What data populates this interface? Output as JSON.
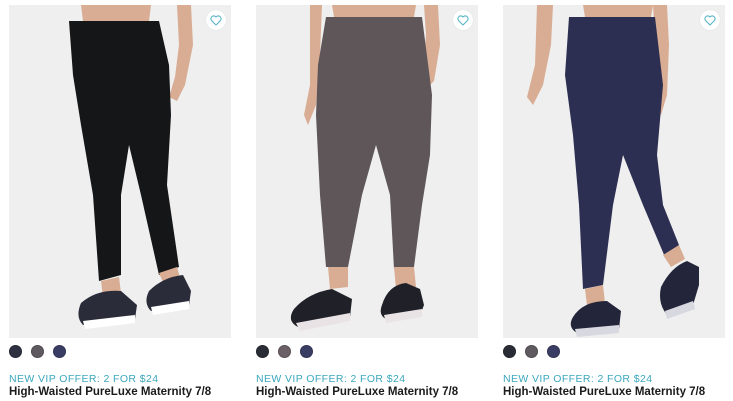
{
  "colors": {
    "photo_bg": "#efefef",
    "offer_text": "#3aa7bd",
    "heart": "#58b5c6",
    "skin": "#d9ad93"
  },
  "products": [
    {
      "offer": "NEW VIP OFFER: 2 FOR $24",
      "name": "High-Waisted PureLuxe Maternity 7/8",
      "legging_color": "#151618",
      "swatches": [
        "#2d3140",
        "#5f5960",
        "#3a3d63"
      ],
      "favorite_icon": "heart-icon"
    },
    {
      "offer": "NEW VIP OFFER: 2 FOR $24",
      "name": "High-Waisted PureLuxe Maternity 7/8",
      "legging_color": "#5e5659",
      "swatches": [
        "#2a2c35",
        "#6a6065",
        "#3a3d63"
      ],
      "favorite_icon": "heart-icon"
    },
    {
      "offer": "NEW VIP OFFER: 2 FOR $24",
      "name": "High-Waisted PureLuxe Maternity 7/8",
      "legging_color": "#2c2f52",
      "swatches": [
        "#2a2c35",
        "#5f5960",
        "#3a3d63"
      ],
      "favorite_icon": "heart-icon"
    }
  ]
}
